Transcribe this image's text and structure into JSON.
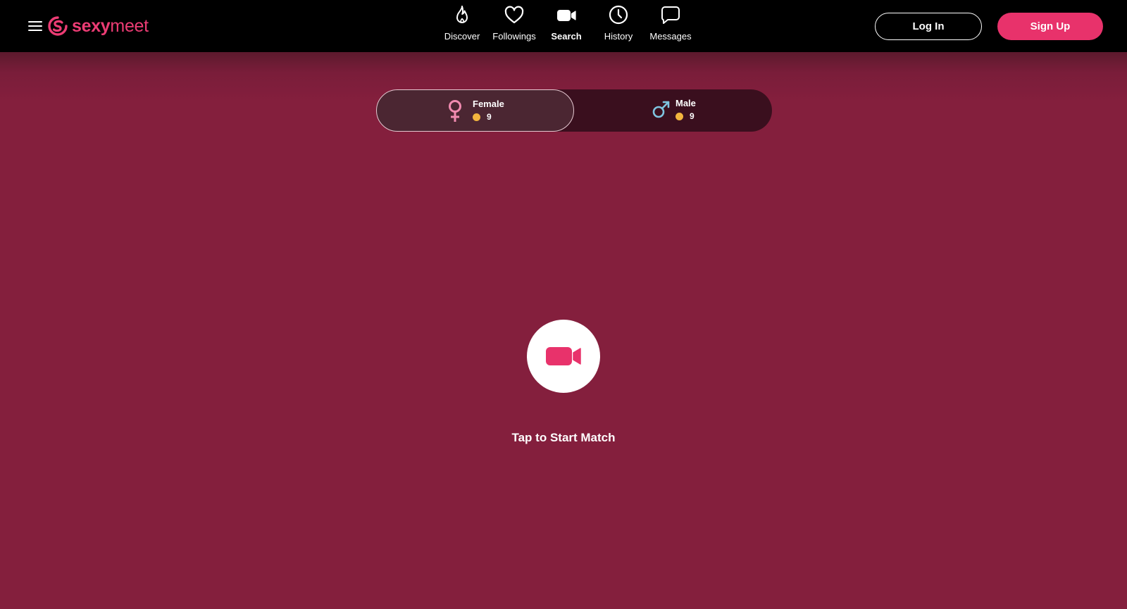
{
  "header": {
    "menu_icon": "hamburger-menu-icon",
    "logo": {
      "part_bold": "sexy",
      "part_light": "meet",
      "icon": "sexymeet-logo-icon"
    },
    "nav": [
      {
        "label": "Discover",
        "icon": "flame-icon",
        "active": false
      },
      {
        "label": "Followings",
        "icon": "heart-icon",
        "active": false
      },
      {
        "label": "Search",
        "icon": "video-camera-icon",
        "active": true
      },
      {
        "label": "History",
        "icon": "clock-icon",
        "active": false
      },
      {
        "label": "Messages",
        "icon": "chat-bubble-icon",
        "active": false
      }
    ],
    "login_label": "Log In",
    "signup_label": "Sign Up"
  },
  "gender_filter": {
    "options": [
      {
        "label": "Female",
        "cost": "9",
        "icon": "female-symbol-icon",
        "selected": true
      },
      {
        "label": "Male",
        "cost": "9",
        "icon": "male-symbol-icon",
        "selected": false
      }
    ],
    "coin_icon": "coin-icon"
  },
  "match": {
    "button_icon": "video-camera-icon",
    "label": "Tap to Start Match"
  },
  "colors": {
    "brand_pink": "#e8326b",
    "background": "#841f3d",
    "coin": "#f2b53e",
    "female_symbol": "#f28bb0",
    "male_symbol": "#7fc4e0"
  }
}
